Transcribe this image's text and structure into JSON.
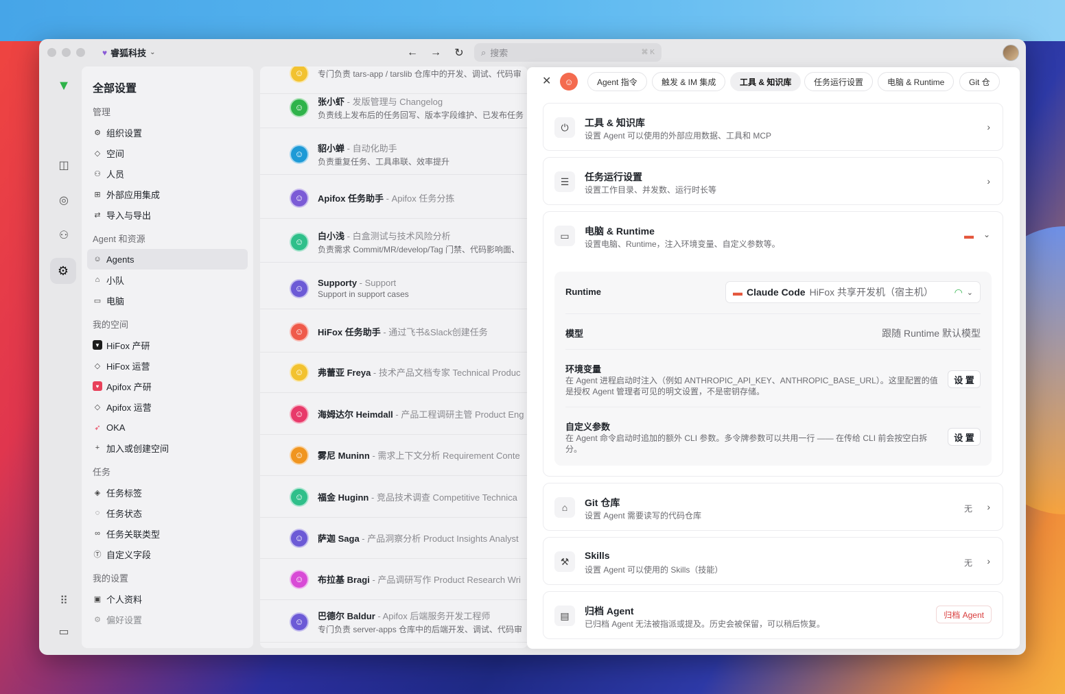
{
  "window": {
    "org_name": "睿狐科技",
    "search_placeholder": "搜索",
    "search_shortcut": "⌘ K"
  },
  "sidebar": {
    "title": "全部设置",
    "sections": [
      {
        "label": "管理",
        "items": [
          "组织设置",
          "空间",
          "人员",
          "外部应用集成",
          "导入与导出"
        ]
      },
      {
        "label": "Agent 和资源",
        "items": [
          "Agents",
          "小队",
          "电脑"
        ]
      },
      {
        "label": "我的空间",
        "items": [
          "HiFox 产研",
          "HiFox 运营",
          "Apifox 产研",
          "Apifox 运营",
          "OKA",
          "加入或创建空间"
        ]
      },
      {
        "label": "任务",
        "items": [
          "任务标签",
          "任务状态",
          "任务关联类型",
          "自定义字段"
        ]
      },
      {
        "label": "我的设置",
        "items": [
          "个人资料",
          "偏好设置"
        ]
      }
    ]
  },
  "agents": [
    {
      "name": "",
      "role": "",
      "desc": "专门负责 tars-app / tarslib 仓库中的开发、调试、代码审",
      "color": "#f2c230"
    },
    {
      "name": "张小虾",
      "role": " - 发版管理与 Changelog",
      "desc": "负责线上发布后的任务回写、版本字段维护、已发布任务",
      "color": "#2fb34a"
    },
    {
      "name": "貂小蝉",
      "role": " - 自动化助手",
      "desc": "负责重复任务、工具串联、效率提升",
      "color": "#1e9ad6"
    },
    {
      "name": "Apifox 任务助手",
      "role": " - Apifox 任务分拣",
      "desc": "",
      "color": "#7b5bd6"
    },
    {
      "name": "白小浅",
      "role": " - 白盒测试与技术风险分析",
      "desc": "负责需求 Commit/MR/develop/Tag 门禁、代码影响面、",
      "color": "#2fbf8a"
    },
    {
      "name": "Supporty",
      "role": " - Support",
      "desc": "Support in support cases",
      "color": "#6c5ad6"
    },
    {
      "name": "HiFox 任务助手",
      "role": " - 通过飞书&Slack创建任务",
      "desc": "",
      "color": "#ef5a4a"
    },
    {
      "name": "弗蕾亚 Freya",
      "role": " - 技术产品文档专家 Technical Produc",
      "desc": "",
      "color": "#f2c230"
    },
    {
      "name": "海姆达尔 Heimdall",
      "role": " - 产品工程调研主管 Product Eng",
      "desc": "",
      "color": "#e83a6a"
    },
    {
      "name": "雾尼 Muninn",
      "role": " - 需求上下文分析 Requirement Conte",
      "desc": "",
      "color": "#f0951f"
    },
    {
      "name": "福金 Huginn",
      "role": " - 竞品技术调查 Competitive Technica",
      "desc": "",
      "color": "#2fbf8a"
    },
    {
      "name": "萨迦 Saga",
      "role": " - 产品洞察分析 Product Insights Analyst",
      "desc": "",
      "color": "#6c5ad6"
    },
    {
      "name": "布拉基 Bragi",
      "role": " - 产品调研写作 Product Research Wri",
      "desc": "",
      "color": "#d84ad6"
    },
    {
      "name": "巴德尔 Baldur",
      "role": " - Apifox 后端服务开发工程师",
      "desc": "专门负责 server-apps 仓库中的后端开发、调试、代码审",
      "color": "#6c5ad6"
    }
  ],
  "panel": {
    "tabs": [
      "Agent 指令",
      "触发 & IM 集成",
      "工具 & 知识库",
      "任务运行设置",
      "电脑 & Runtime",
      "Git 仓"
    ],
    "active_tab": "工具 & 知识库",
    "tools": {
      "title": "工具 & 知识库",
      "subtitle": "设置 Agent 可以使用的外部应用数据、工具和 MCP"
    },
    "task_run": {
      "title": "任务运行设置",
      "subtitle": "设置工作目录、并发数、运行时长等"
    },
    "computer": {
      "title": "电脑 & Runtime",
      "subtitle": "设置电脑、Runtime，注入环境变量、自定义参数等。",
      "runtime_label": "Runtime",
      "runtime_name": "Claude Code",
      "runtime_host": "HiFox 共享开发机（宿主机）",
      "model_label": "模型",
      "model_value": "跟随 Runtime 默认模型",
      "env_label": "环境变量",
      "env_desc": "在 Agent 进程启动时注入（例如 ANTHROPIC_API_KEY、ANTHROPIC_BASE_URL）。这里配置的值是授权 Agent 管理者可见的明文设置，不是密钥存储。",
      "env_button": "设 置",
      "args_label": "自定义参数",
      "args_desc": "在 Agent 命令启动时追加的额外 CLI 参数。多令牌参数可以共用一行 —— 在传给 CLI 前会按空白拆分。",
      "args_button": "设 置"
    },
    "git": {
      "title": "Git 仓库",
      "subtitle": "设置 Agent 需要读写的代码仓库",
      "value": "无"
    },
    "skills": {
      "title": "Skills",
      "subtitle": "设置 Agent 可以使用的 Skills（技能）",
      "value": "无"
    },
    "archive": {
      "title": "归档 Agent",
      "subtitle": "已归档 Agent 无法被指派或提及。历史会被保留，可以稍后恢复。",
      "button": "归档 Agent"
    }
  }
}
